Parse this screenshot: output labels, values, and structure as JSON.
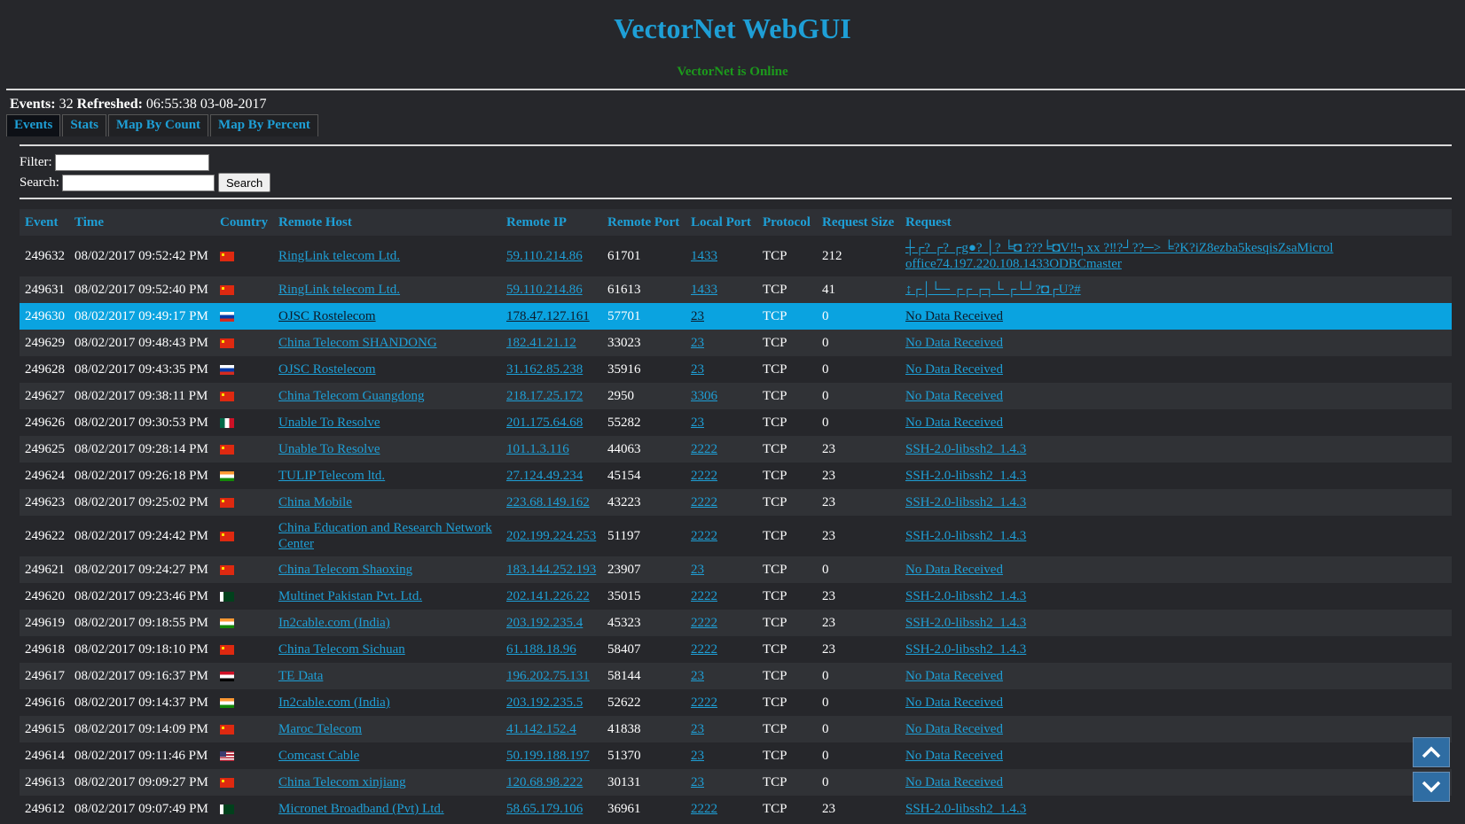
{
  "app": {
    "title": "VectorNet WebGUI",
    "status": "VectorNet is Online"
  },
  "summary": {
    "events_label": "Events:",
    "events_count": "32",
    "refreshed_label": "Refreshed:",
    "refreshed_value": "06:55:38 03-08-2017"
  },
  "tabs": [
    {
      "label": "Events",
      "active": true
    },
    {
      "label": "Stats",
      "active": false
    },
    {
      "label": "Map By Count",
      "active": false
    },
    {
      "label": "Map By Percent",
      "active": false
    }
  ],
  "filter": {
    "label": "Filter:",
    "value": ""
  },
  "search": {
    "label": "Search:",
    "value": "",
    "button_label": "Search"
  },
  "table": {
    "columns": [
      "Event",
      "Time",
      "Country",
      "Remote Host",
      "Remote IP",
      "Remote Port",
      "Local Port",
      "Protocol",
      "Request Size",
      "Request"
    ],
    "rows": [
      {
        "event": "249632",
        "time": "08/02/2017 09:52:42 PM",
        "flag": "cn",
        "host": "RingLink telecom Ltd.",
        "ip": "59.110.214.86",
        "rport": "61701",
        "lport": "1433",
        "proto": "TCP",
        "size": "212",
        "request": "┼┌? ┌? ┌g●? │? ╘◘ ???╘◘V‼┐xx ?‼?┘??─> ╘?K?iZ8ezba5kesqisZsaMicrol office74.197.220.108.1433ODBCmaster"
      },
      {
        "event": "249631",
        "time": "08/02/2017 09:52:40 PM",
        "flag": "cn",
        "host": "RingLink telecom Ltd.",
        "ip": "59.110.214.86",
        "rport": "61613",
        "lport": "1433",
        "proto": "TCP",
        "size": "41",
        "request": "↨┌│└─ ┌┌ ┌┐└ ┌└┘?◘┌U?#"
      },
      {
        "event": "249630",
        "time": "08/02/2017 09:49:17 PM",
        "flag": "ru",
        "host": "OJSC Rostelecom",
        "ip": "178.47.127.161",
        "rport": "57701",
        "lport": "23",
        "proto": "TCP",
        "size": "0",
        "request": "No Data Received"
      },
      {
        "event": "249629",
        "time": "08/02/2017 09:48:43 PM",
        "flag": "cn",
        "host": "China Telecom SHANDONG",
        "ip": "182.41.21.12",
        "rport": "33023",
        "lport": "23",
        "proto": "TCP",
        "size": "0",
        "request": "No Data Received"
      },
      {
        "event": "249628",
        "time": "08/02/2017 09:43:35 PM",
        "flag": "ru",
        "host": "OJSC Rostelecom",
        "ip": "31.162.85.238",
        "rport": "35916",
        "lport": "23",
        "proto": "TCP",
        "size": "0",
        "request": "No Data Received"
      },
      {
        "event": "249627",
        "time": "08/02/2017 09:38:11 PM",
        "flag": "cn",
        "host": "China Telecom Guangdong",
        "ip": "218.17.25.172",
        "rport": "2950",
        "lport": "3306",
        "proto": "TCP",
        "size": "0",
        "request": "No Data Received"
      },
      {
        "event": "249626",
        "time": "08/02/2017 09:30:53 PM",
        "flag": "mx",
        "host": "Unable To Resolve",
        "ip": "201.175.64.68",
        "rport": "55282",
        "lport": "23",
        "proto": "TCP",
        "size": "0",
        "request": "No Data Received"
      },
      {
        "event": "249625",
        "time": "08/02/2017 09:28:14 PM",
        "flag": "cn",
        "host": "Unable To Resolve",
        "ip": "101.1.3.116",
        "rport": "44063",
        "lport": "2222",
        "proto": "TCP",
        "size": "23",
        "request": "SSH-2.0-libssh2_1.4.3"
      },
      {
        "event": "249624",
        "time": "08/02/2017 09:26:18 PM",
        "flag": "in",
        "host": "TULIP Telecom ltd.",
        "ip": "27.124.49.234",
        "rport": "45154",
        "lport": "2222",
        "proto": "TCP",
        "size": "23",
        "request": "SSH-2.0-libssh2_1.4.3"
      },
      {
        "event": "249623",
        "time": "08/02/2017 09:25:02 PM",
        "flag": "cn",
        "host": "China Mobile",
        "ip": "223.68.149.162",
        "rport": "43223",
        "lport": "2222",
        "proto": "TCP",
        "size": "23",
        "request": "SSH-2.0-libssh2_1.4.3"
      },
      {
        "event": "249622",
        "time": "08/02/2017 09:24:42 PM",
        "flag": "cn",
        "host": "China Education and Research Network Center",
        "ip": "202.199.224.253",
        "rport": "51197",
        "lport": "2222",
        "proto": "TCP",
        "size": "23",
        "request": "SSH-2.0-libssh2_1.4.3"
      },
      {
        "event": "249621",
        "time": "08/02/2017 09:24:27 PM",
        "flag": "cn",
        "host": "China Telecom Shaoxing",
        "ip": "183.144.252.193",
        "rport": "23907",
        "lport": "23",
        "proto": "TCP",
        "size": "0",
        "request": "No Data Received"
      },
      {
        "event": "249620",
        "time": "08/02/2017 09:23:46 PM",
        "flag": "pk",
        "host": "Multinet Pakistan Pvt. Ltd.",
        "ip": "202.141.226.22",
        "rport": "35015",
        "lport": "2222",
        "proto": "TCP",
        "size": "23",
        "request": "SSH-2.0-libssh2_1.4.3"
      },
      {
        "event": "249619",
        "time": "08/02/2017 09:18:55 PM",
        "flag": "in",
        "host": "In2cable.com (India)",
        "ip": "203.192.235.4",
        "rport": "45323",
        "lport": "2222",
        "proto": "TCP",
        "size": "23",
        "request": "SSH-2.0-libssh2_1.4.3"
      },
      {
        "event": "249618",
        "time": "08/02/2017 09:18:10 PM",
        "flag": "cn",
        "host": "China Telecom Sichuan",
        "ip": "61.188.18.96",
        "rport": "58407",
        "lport": "2222",
        "proto": "TCP",
        "size": "23",
        "request": "SSH-2.0-libssh2_1.4.3"
      },
      {
        "event": "249617",
        "time": "08/02/2017 09:16:37 PM",
        "flag": "eg",
        "host": "TE Data",
        "ip": "196.202.75.131",
        "rport": "58144",
        "lport": "23",
        "proto": "TCP",
        "size": "0",
        "request": "No Data Received"
      },
      {
        "event": "249616",
        "time": "08/02/2017 09:14:37 PM",
        "flag": "in",
        "host": "In2cable.com (India)",
        "ip": "203.192.235.5",
        "rport": "52622",
        "lport": "2222",
        "proto": "TCP",
        "size": "0",
        "request": "No Data Received"
      },
      {
        "event": "249615",
        "time": "08/02/2017 09:14:09 PM",
        "flag": "cn",
        "host": "Maroc Telecom",
        "ip": "41.142.152.4",
        "rport": "41838",
        "lport": "23",
        "proto": "TCP",
        "size": "0",
        "request": "No Data Received"
      },
      {
        "event": "249614",
        "time": "08/02/2017 09:11:46 PM",
        "flag": "us",
        "host": "Comcast Cable",
        "ip": "50.199.188.197",
        "rport": "51370",
        "lport": "23",
        "proto": "TCP",
        "size": "0",
        "request": "No Data Received"
      },
      {
        "event": "249613",
        "time": "08/02/2017 09:09:27 PM",
        "flag": "cn",
        "host": "China Telecom xinjiang",
        "ip": "120.68.98.222",
        "rport": "30131",
        "lport": "23",
        "proto": "TCP",
        "size": "0",
        "request": "No Data Received"
      },
      {
        "event": "249612",
        "time": "08/02/2017 09:07:49 PM",
        "flag": "pk",
        "host": "Micronet Broadband (Pvt) Ltd.",
        "ip": "58.65.179.106",
        "rport": "36961",
        "lport": "2222",
        "proto": "TCP",
        "size": "23",
        "request": "SSH-2.0-libssh2_1.4.3"
      }
    ],
    "selected_row_index": 2
  },
  "icons": {
    "scroll_up": "chevron-up-icon",
    "scroll_down": "chevron-down-icon"
  },
  "colors": {
    "accent": "#1e9fd6",
    "online": "#1c9a1c",
    "selected_row": "#0aa3e0",
    "background": "#26272b"
  }
}
